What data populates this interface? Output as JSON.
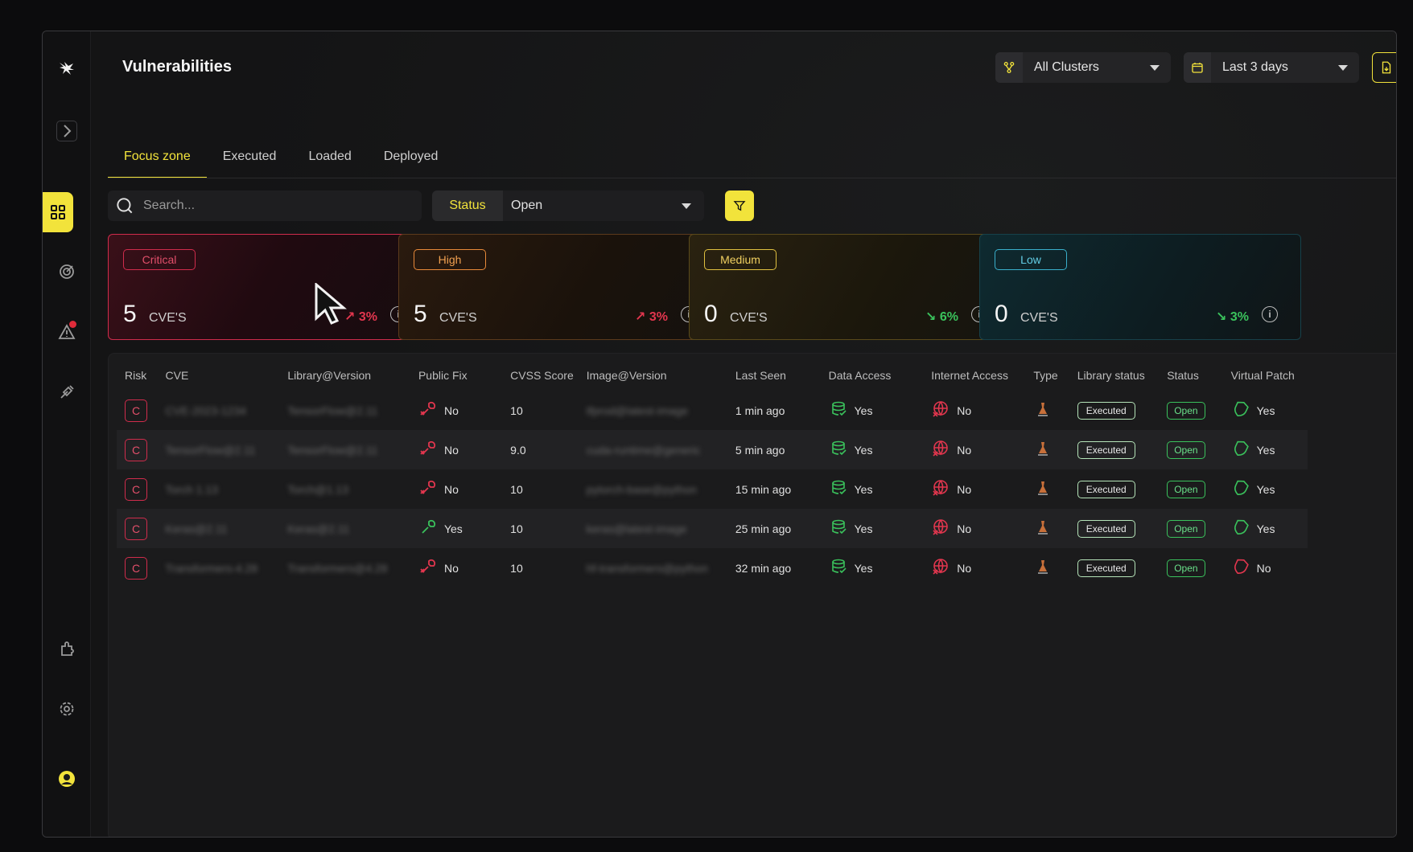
{
  "page_title": "Vulnerabilities",
  "top_selectors": {
    "clusters": "All Clusters",
    "date_range": "Last 3 days"
  },
  "tabs": [
    {
      "label": "Focus zone",
      "active": true
    },
    {
      "label": "Executed",
      "active": false
    },
    {
      "label": "Loaded",
      "active": false
    },
    {
      "label": "Deployed",
      "active": false
    }
  ],
  "search": {
    "placeholder": "Search..."
  },
  "status_filter": {
    "label": "Status",
    "value": "Open"
  },
  "cards": [
    {
      "badge": "Critical",
      "count": "5",
      "unit": "CVE'S",
      "trend": "↗ 3%",
      "trend_color": "#e2364e"
    },
    {
      "badge": "High",
      "count": "5",
      "unit": "CVE'S",
      "trend": "↗ 3%",
      "trend_color": "#e2364e"
    },
    {
      "badge": "Medium",
      "count": "0",
      "unit": "CVE'S",
      "trend": "↘ 6%",
      "trend_color": "#3ac25c"
    },
    {
      "badge": "Low",
      "count": "0",
      "unit": "CVE'S",
      "trend": "↘ 3%",
      "trend_color": "#3ac25c"
    }
  ],
  "table": {
    "columns": [
      "Risk",
      "CVE",
      "Library@Version",
      "Public Fix",
      "CVSS Score",
      "Image@Version",
      "Last Seen",
      "Data Access",
      "Internet Access",
      "Type",
      "Library status",
      "Status",
      "Virtual Patch"
    ],
    "rows": [
      {
        "risk": "C",
        "cve": "CVE-2023-1234",
        "library": "TensorFlow@2.11",
        "public_fix": "No",
        "cvss": "10",
        "image": "tfprod@latest-image",
        "last_seen": "1 min ago",
        "data_access": "Yes",
        "internet_access": "No",
        "library_status": "Executed",
        "status": "Open",
        "virtual_patch": "Yes"
      },
      {
        "risk": "C",
        "cve": "TensorFlow@2.11",
        "library": "TensorFlow@2.11",
        "public_fix": "No",
        "cvss": "9.0",
        "image": "cuda-runtime@generic",
        "last_seen": "5 min ago",
        "data_access": "Yes",
        "internet_access": "No",
        "library_status": "Executed",
        "status": "Open",
        "virtual_patch": "Yes"
      },
      {
        "risk": "C",
        "cve": "Torch 1.13",
        "library": "Torch@1.13",
        "public_fix": "No",
        "cvss": "10",
        "image": "pytorch-base@python",
        "last_seen": "15 min ago",
        "data_access": "Yes",
        "internet_access": "No",
        "library_status": "Executed",
        "status": "Open",
        "virtual_patch": "Yes"
      },
      {
        "risk": "C",
        "cve": "Keras@2.11",
        "library": "Keras@2.11",
        "public_fix": "Yes",
        "cvss": "10",
        "image": "keras@latest-image",
        "last_seen": "25 min ago",
        "data_access": "Yes",
        "internet_access": "No",
        "library_status": "Executed",
        "status": "Open",
        "virtual_patch": "Yes"
      },
      {
        "risk": "C",
        "cve": "Transformers-4.28",
        "library": "Transformers@4.28",
        "public_fix": "No",
        "cvss": "10",
        "image": "hf-transformers@python",
        "last_seen": "32 min ago",
        "data_access": "Yes",
        "internet_access": "No",
        "library_status": "Executed",
        "status": "Open",
        "virtual_patch": "No"
      }
    ]
  },
  "colors": {
    "accent": "#f2e33b",
    "critical": "#d02c4c",
    "high": "#e88a3a",
    "medium": "#e0c040",
    "low": "#3ab0cc",
    "positive": "#3ac25c",
    "negative": "#e2364e"
  },
  "icons": {
    "sidebar": [
      "logo-bird-icon",
      "expand-chevron-icon",
      "dashboard-grid-icon",
      "radar-icon",
      "warning-triangle-icon",
      "tools-icon",
      "plugin-icon",
      "gear-icon",
      "user-avatar-icon"
    ]
  }
}
